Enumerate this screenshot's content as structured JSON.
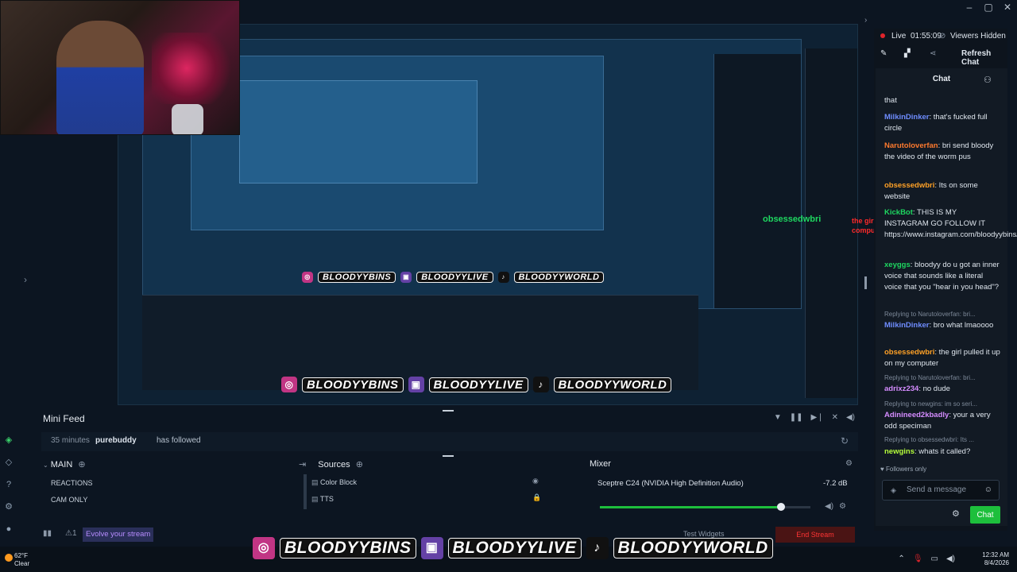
{
  "window_controls": {
    "min": "–",
    "max": "▢",
    "close": "✕"
  },
  "stream_status": {
    "live_label": "Live",
    "live_time": "01:55:09",
    "viewers": "Viewers Hidden",
    "refresh_chat": "Refresh Chat"
  },
  "chat": {
    "header": "Chat",
    "messages": [
      {
        "user": "",
        "text": "that",
        "color": "#dfe6ee"
      },
      {
        "user": "MilkinDinker",
        "text": ": that's fucked full circle",
        "color": "#6f8dff"
      },
      {
        "user": "Narutoloverfan",
        "text": ": bri send bloody the video of the worm pus",
        "color": "#ff7a2e"
      },
      {
        "user": "obsessedwbri",
        "text": ": Its on some website",
        "color": "#ffa126"
      },
      {
        "user": "KickBot",
        "text": ": THIS IS MY INSTAGRAM GO FOLLOW IT https://www.instagram.com/bloodyybins/",
        "color": "#1ed760"
      },
      {
        "user": "xeyggs",
        "text": ": bloodyy do u got an inner voice that sounds like a literal voice that you \"hear in you head\"?",
        "color": "#1ed760"
      },
      {
        "user": "MilkinDinker",
        "text": ": bro what lmaoooo",
        "color": "#6f8dff"
      },
      {
        "user": "obsessedwbri",
        "text": ": the girl pulled it up on my computer",
        "color": "#ffa126"
      },
      {
        "user": "adrixz234",
        "text": ": no dude",
        "color": "#d58cff"
      },
      {
        "user": "Adinineed2kbadly",
        "text": ": your a very odd speciman",
        "color": "#d58cff"
      },
      {
        "user": "newgins",
        "text": ": whats it called?",
        "color": "#b6ff3b"
      }
    ],
    "replies": [
      "Replying to Narutoloverfan: bri...",
      "Replying to Narutoloverfan: bri...",
      "Replying to newgins: im so seri...",
      "Replying to obsessedwbri: Its ..."
    ],
    "followers_only": "Followers only",
    "input_placeholder": "Send a message",
    "send_label": "Chat",
    "overlay_user": "obsessedwbri",
    "overlay_text": "the girl pulled it up on my computer"
  },
  "mini_feed": {
    "title": "Mini Feed",
    "rows": [
      {
        "time": "35 minutes",
        "user": "purebuddy",
        "action": "has followed"
      }
    ]
  },
  "scenes": {
    "title": "MAIN",
    "items": [
      "REACTIONS",
      "CAM ONLY"
    ]
  },
  "sources": {
    "title": "Sources",
    "items": [
      "Color Block",
      "TTS"
    ]
  },
  "mixer": {
    "title": "Mixer",
    "device": "Sceptre C24 (NVIDIA High Definition Audio)",
    "level": "-7.2 dB",
    "volume_fraction": 0.86
  },
  "status_bar": {
    "evolve": "Evolve your stream",
    "test_widgets": "Test Widgets",
    "end_stream": "End Stream"
  },
  "socials": {
    "instagram": "BLOODYYBINS",
    "twitch": "BLOODYYLIVE",
    "tiktok": "BLOODYYWORLD"
  },
  "taskbar": {
    "temp": "62°F",
    "weather": "Clear",
    "time": "12:32 AM",
    "date": "8/4/2026"
  },
  "colors": {
    "accent_green": "#1dbf3c",
    "live_red": "#e0242b"
  }
}
